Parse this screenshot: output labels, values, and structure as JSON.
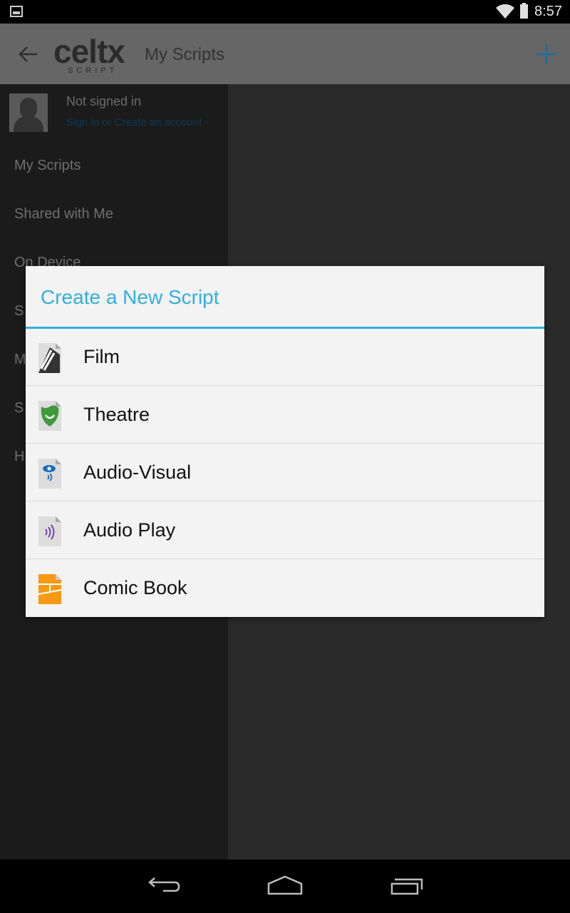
{
  "status_bar": {
    "notification_icon": "gallery-icon",
    "wifi_icon": "wifi-icon",
    "battery_icon": "battery-icon",
    "time": "8:57"
  },
  "action_bar": {
    "back_icon": "arrow-left-icon",
    "logo_text": "celtx",
    "logo_subtext": "SCRIPT",
    "title": "My Scripts",
    "add_icon": "plus-icon",
    "accent_color": "#1e6e9a"
  },
  "drawer": {
    "account_status": "Not signed in",
    "signin_link": "Sign in or Create an account",
    "items": [
      {
        "label": "My Scripts"
      },
      {
        "label": "Shared with Me"
      },
      {
        "label": "On Device"
      },
      {
        "label": "S"
      },
      {
        "label": "M"
      },
      {
        "label": "S"
      },
      {
        "label": "H"
      }
    ]
  },
  "dialog": {
    "title": "Create a New Script",
    "accent_color": "#33aede",
    "options": [
      {
        "label": "Film",
        "icon": "film-clapper-icon"
      },
      {
        "label": "Theatre",
        "icon": "theatre-mask-icon"
      },
      {
        "label": "Audio-Visual",
        "icon": "eye-audio-icon"
      },
      {
        "label": "Audio Play",
        "icon": "audio-waves-icon"
      },
      {
        "label": "Comic Book",
        "icon": "comic-panels-icon"
      }
    ]
  },
  "nav_bar": {
    "back_icon": "back-icon",
    "home_icon": "home-icon",
    "recents_icon": "recents-icon"
  }
}
